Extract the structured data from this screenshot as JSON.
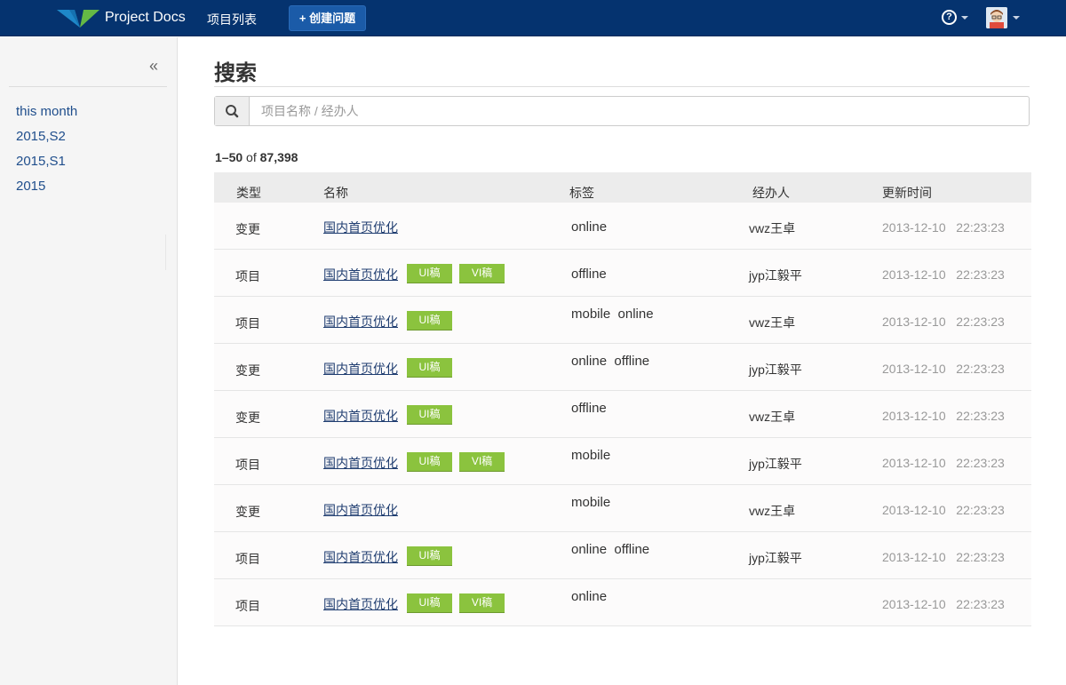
{
  "header": {
    "brand": "Project Docs",
    "nav_projects": "项目列表",
    "create_button": "+ 创建问题",
    "help_symbol": "?",
    "colors": {
      "bar": "#05336f",
      "button": "#1b5ba8",
      "logo_blue": "#1e88c9",
      "logo_green": "#65b945"
    }
  },
  "sidebar": {
    "collapse_symbol": "«",
    "items": [
      {
        "label": "this month"
      },
      {
        "label": "2015,S2"
      },
      {
        "label": "2015,S1"
      },
      {
        "label": "2015"
      }
    ]
  },
  "main": {
    "title": "搜索",
    "search_placeholder": "项目名称 / 经办人",
    "count": {
      "range": "1–50",
      "of": "of",
      "total": "87,398"
    },
    "columns": {
      "type": "类型",
      "name": "名称",
      "tags": "标签",
      "owner": "经办人",
      "updated": "更新时间"
    },
    "rows": [
      {
        "type": "变更",
        "name": "国内首页优化",
        "badges": [],
        "tags": "online",
        "owner": "vwz王卓",
        "updated": "2013-12-10   22:23:23"
      },
      {
        "type": "项目",
        "name": "国内首页优化",
        "badges": [
          "UI稿",
          "VI稿"
        ],
        "tags": "offline",
        "owner": " jyp江毅平",
        "updated": "2013-12-10   22:23:23"
      },
      {
        "type": "项目",
        "name": "国内首页优化",
        "badges": [
          "UI稿"
        ],
        "tags": "mobile  online",
        "owner": "vwz王卓",
        "updated": "2013-12-10   22:23:23"
      },
      {
        "type": "变更",
        "name": "国内首页优化",
        "badges": [
          "UI稿"
        ],
        "tags": "online  offline",
        "owner": " jyp江毅平",
        "updated": "2013-12-10   22:23:23"
      },
      {
        "type": "变更",
        "name": "国内首页优化",
        "badges": [
          "UI稿"
        ],
        "tags": "offline",
        "owner": "vwz王卓",
        "updated": "2013-12-10   22:23:23"
      },
      {
        "type": "项目",
        "name": "国内首页优化",
        "badges": [
          "UI稿",
          "VI稿"
        ],
        "tags": "mobile",
        "owner": " jyp江毅平",
        "updated": "2013-12-10   22:23:23"
      },
      {
        "type": "变更",
        "name": "国内首页优化",
        "badges": [],
        "tags": "mobile",
        "owner": "vwz王卓",
        "updated": "2013-12-10   22:23:23"
      },
      {
        "type": "项目",
        "name": "国内首页优化",
        "badges": [
          "UI稿"
        ],
        "tags": "online  offline",
        "owner": " jyp江毅平",
        "updated": "2013-12-10   22:23:23"
      },
      {
        "type": "项目",
        "name": "国内首页优化",
        "badges": [
          "UI稿",
          "VI稿"
        ],
        "tags": "online",
        "owner": "",
        "updated": "2013-12-10   22:23:23"
      }
    ],
    "badge_color": "#8bc33e"
  }
}
